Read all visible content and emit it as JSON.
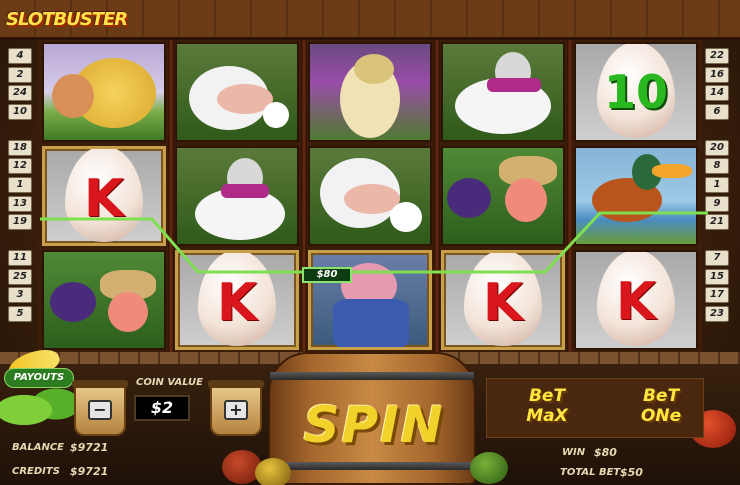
{
  "logo": {
    "text": "SLOTBUSTER"
  },
  "paylines": {
    "left": [
      "4",
      "2",
      "24",
      "10",
      "18",
      "12",
      "1",
      "13",
      "19",
      "11",
      "25",
      "3",
      "5"
    ],
    "right": [
      "22",
      "16",
      "14",
      "6",
      "20",
      "8",
      "1",
      "9",
      "21",
      "7",
      "15",
      "17",
      "23"
    ]
  },
  "reels": [
    [
      {
        "symbol": "sheep"
      },
      {
        "symbol": "K",
        "glyph": "K"
      },
      {
        "symbol": "scarecrow"
      }
    ],
    [
      {
        "symbol": "cow"
      },
      {
        "symbol": "turkey"
      },
      {
        "symbol": "K",
        "glyph": "K"
      }
    ],
    [
      {
        "symbol": "horse"
      },
      {
        "symbol": "cow"
      },
      {
        "symbol": "farmer-pig"
      }
    ],
    [
      {
        "symbol": "turkey"
      },
      {
        "symbol": "scarecrow"
      },
      {
        "symbol": "K",
        "glyph": "K"
      }
    ],
    [
      {
        "symbol": "10",
        "glyph": "10"
      },
      {
        "symbol": "duck"
      },
      {
        "symbol": "K",
        "glyph": "K"
      }
    ]
  ],
  "win_line": {
    "amount": "$80",
    "color": "#7ee04e"
  },
  "controls": {
    "payouts_label": "PAYOUTS",
    "coin_value_label": "COIN VALUE",
    "coin_value": "$2",
    "minus_label": "−",
    "plus_label": "+",
    "balance_label": "BALANCE",
    "balance_value": "$9721",
    "credits_label": "CREDITS",
    "credits_value": "$9721",
    "spin_label": "SPIN",
    "bet_max_line1": "BeT",
    "bet_max_line2": "MaX",
    "bet_one_line1": "BeT",
    "bet_one_line2": "ONe",
    "win_label": "WIN",
    "win_value": "$80",
    "total_bet_label": "TOTAL BET",
    "total_bet_value": "$50"
  },
  "colors": {
    "k_red": "#d8161b",
    "ten_green": "#29b81f",
    "gold": "#f2d12a"
  }
}
